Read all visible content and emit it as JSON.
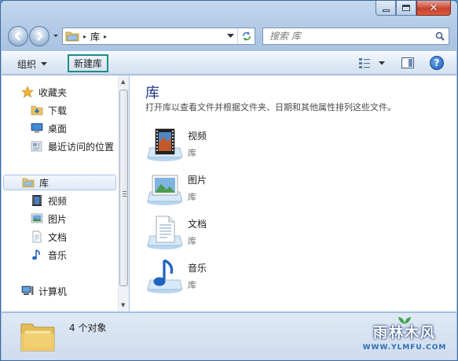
{
  "window": {
    "caption_buttons": [
      "minimize",
      "maximize",
      "close"
    ]
  },
  "address_bar": {
    "crumbs": [
      "库"
    ],
    "separator": "▸"
  },
  "search": {
    "placeholder": "搜索 库"
  },
  "command_bar": {
    "organize_label": "组织",
    "new_library_label": "新建库"
  },
  "nav_pane": {
    "favorites": {
      "label": "收藏夹",
      "items": [
        {
          "label": "下载",
          "icon": "download-folder-icon"
        },
        {
          "label": "桌面",
          "icon": "desktop-icon"
        },
        {
          "label": "最近访问的位置",
          "icon": "recent-places-icon"
        }
      ]
    },
    "libraries": {
      "label": "库",
      "items": [
        {
          "label": "视频",
          "icon": "video-library-icon"
        },
        {
          "label": "图片",
          "icon": "picture-library-icon"
        },
        {
          "label": "文档",
          "icon": "document-library-icon"
        },
        {
          "label": "音乐",
          "icon": "music-library-icon"
        }
      ]
    },
    "computer": {
      "label": "计算机"
    }
  },
  "content": {
    "title": "库",
    "description": "打开库以查看文件并根据文件夹、日期和其他属性排列这些文件。",
    "items": [
      {
        "name": "视频",
        "type": "库",
        "icon": "video-library-icon"
      },
      {
        "name": "图片",
        "type": "库",
        "icon": "picture-library-icon"
      },
      {
        "name": "文档",
        "type": "库",
        "icon": "document-library-icon"
      },
      {
        "name": "音乐",
        "type": "库",
        "icon": "music-library-icon"
      }
    ]
  },
  "status_bar": {
    "count_text": "4 个对象"
  },
  "watermark": {
    "brand": "雨林木风",
    "url": "WWW.YLMFU.COM"
  },
  "colors": {
    "accent_title": "#1e3287",
    "highlight_border": "#1d8c86"
  }
}
